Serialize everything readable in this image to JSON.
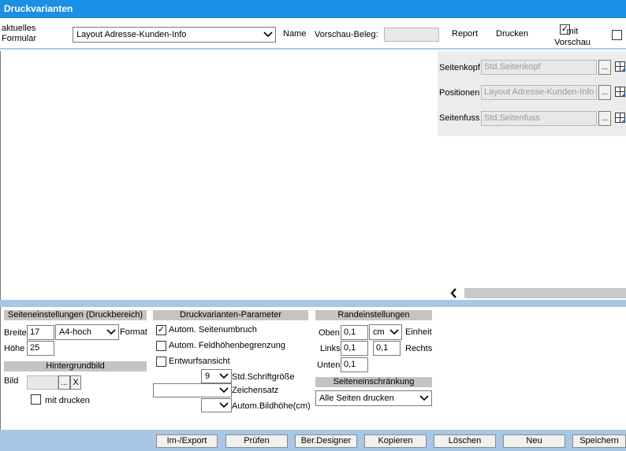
{
  "window": {
    "title": "Druckvarianten"
  },
  "topbar": {
    "aktuelles_formular_label": "aktuelles\nFormular",
    "formular_value": "Layout Adresse-Kunden-Info",
    "name_label": "Name",
    "vorschau_beleg_label": "Vorschau-Beleg:",
    "vorschau_beleg_value": "",
    "report_label": "Report",
    "drucken_label": "Drucken",
    "mit_vorschau_label": "mit\nVorschau",
    "mit_vorschau_checked": "✓"
  },
  "sections_panel": {
    "seitenkopf_label": "Seitenkopf",
    "seitenkopf_value": "Std.Seitenkopf",
    "positionen_label": "Positionen",
    "positionen_value": "Layout Adresse-Kunden-Info",
    "seitenfuss_label": "Seitenfuss",
    "seitenfuss_value": "Std.Seitenfuss",
    "browse_label": "..."
  },
  "seiteneinstellungen": {
    "header": "Seiteneinstellungen (Druckbereich)",
    "breite_label": "Breite",
    "breite_value": "17",
    "format_value": "A4-hoch",
    "format_label": "Format",
    "hoehe_label": "Höhe",
    "hoehe_value": "25"
  },
  "hintergrundbild": {
    "header": "Hintergrundbild",
    "bild_label": "Bild",
    "bild_value": "",
    "browse_label": "...",
    "clear_label": "X",
    "mit_drucken_label": "mit drucken"
  },
  "parameter": {
    "header": "Druckvarianten-Parameter",
    "autom_seitenumbruch": "Autom. Seitenumbruch",
    "autom_seitenumbruch_checked": "✓",
    "autom_feldhoehen": "Autom. Feldhöhenbegrenzung",
    "entwurfsansicht": "Entwurfsansicht",
    "schriftgroesse_value": "9",
    "schriftgroesse_label": "Std.Schriftgröße",
    "zeichensatz_value": "",
    "zeichensatz_label": "Zeichensatz",
    "bildhoehe_value": "",
    "bildhoehe_label": "Autom.Bildhöhe(cm)"
  },
  "randeinstellungen": {
    "header": "Randeinstellungen",
    "oben_label": "Oben",
    "oben_value": "0,1",
    "einheit_value": "cm",
    "einheit_label": "Einheit",
    "links_label": "Links",
    "links_value": "0,1",
    "rechts_value": "0,1",
    "rechts_label": "Rechts",
    "unten_label": "Unten",
    "unten_value": "0,1"
  },
  "seiteneinschraenkung": {
    "header": "Seiteneinschränkung",
    "value": "Alle Seiten drucken"
  },
  "footer": {
    "im_export": "Im-/Export",
    "pruefen": "Prüfen",
    "ber_designer": "Ber.Designer",
    "kopieren": "Kopieren",
    "loeschen": "Löschen",
    "neu": "Neu",
    "speichern": "Speichern"
  },
  "icons": {
    "chevron": "chevron-down-icon",
    "grid": "grid-edit-icon",
    "scroll_left": "chevron-left-icon"
  },
  "colors": {
    "titlebar": "#1a8fe3",
    "band": "#a8c6e6",
    "section_header": "#c4c4c4"
  }
}
